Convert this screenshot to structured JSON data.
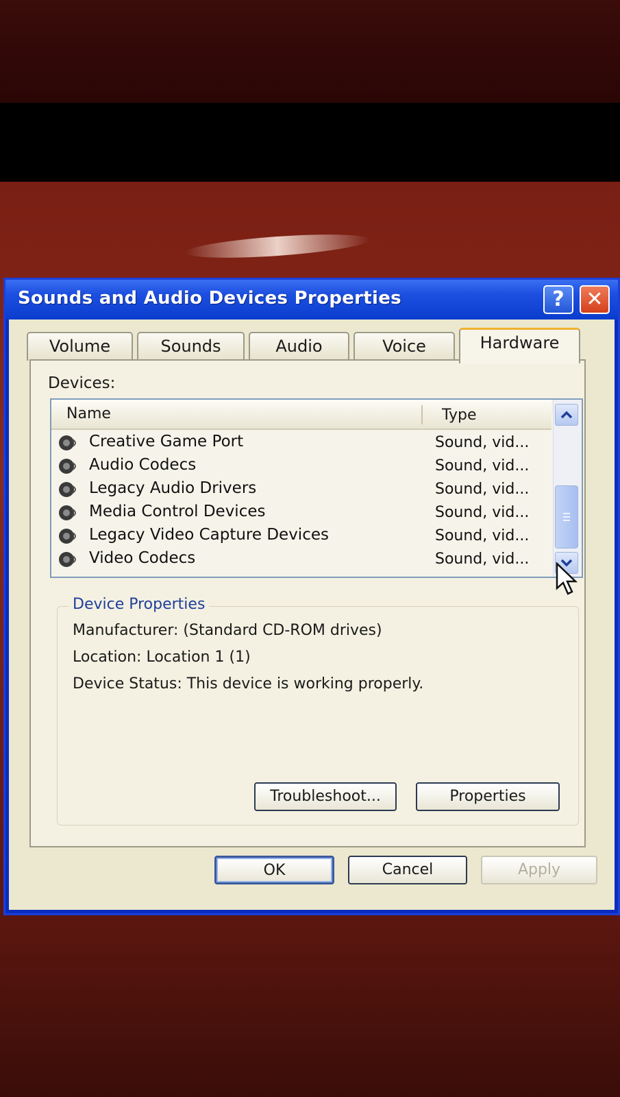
{
  "window": {
    "title": "Sounds and Audio Devices Properties",
    "help_label": "?",
    "close_label": "✕"
  },
  "tabs": [
    {
      "label": "Volume",
      "active": false
    },
    {
      "label": "Sounds",
      "active": false
    },
    {
      "label": "Audio",
      "active": false
    },
    {
      "label": "Voice",
      "active": false
    },
    {
      "label": "Hardware",
      "active": true
    }
  ],
  "devices": {
    "label": "Devices:",
    "columns": {
      "name": "Name",
      "type": "Type"
    },
    "rows": [
      {
        "name": "Creative Game Port",
        "type": "Sound, vid..."
      },
      {
        "name": "Audio Codecs",
        "type": "Sound, vid..."
      },
      {
        "name": "Legacy Audio Drivers",
        "type": "Sound, vid..."
      },
      {
        "name": "Media Control Devices",
        "type": "Sound, vid..."
      },
      {
        "name": "Legacy Video Capture Devices",
        "type": "Sound, vid..."
      },
      {
        "name": "Video Codecs",
        "type": "Sound, vid..."
      }
    ],
    "row_icon": "speaker-icon"
  },
  "device_properties": {
    "title": "Device Properties",
    "manufacturer": "Manufacturer: (Standard CD-ROM drives)",
    "location": "Location: Location 1 (1)",
    "status": "Device Status: This device is working properly.",
    "troubleshoot_label": "Troubleshoot...",
    "properties_label": "Properties"
  },
  "footer": {
    "ok_label": "OK",
    "cancel_label": "Cancel",
    "apply_label": "Apply"
  },
  "colors": {
    "titlebar": "#0a3ccd",
    "dialog_bg": "#ece7cf",
    "active_tab_accent": "#f0b030",
    "group_title": "#1f3f9a"
  }
}
